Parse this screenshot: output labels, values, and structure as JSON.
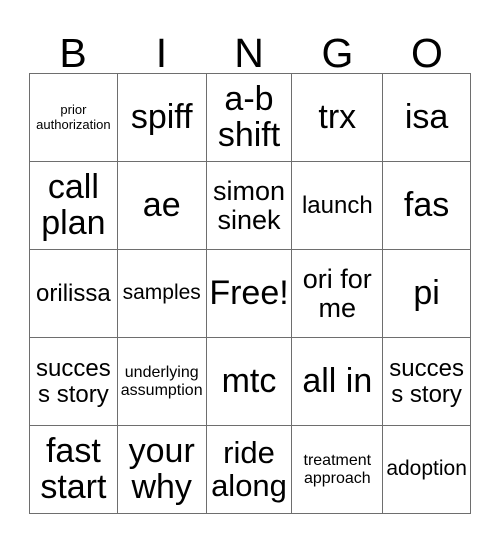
{
  "card": {
    "title_letters": [
      "B",
      "I",
      "N",
      "G",
      "O"
    ],
    "free_space_label": "Free!",
    "border_color": "#6e6e6e",
    "text_color": "#000000",
    "background_color": "#ffffff",
    "rows": [
      [
        {
          "text": "prior authorization",
          "size": "sz-xs"
        },
        {
          "text": "spiff",
          "size": "sz-xxl"
        },
        {
          "text": "a-b shift",
          "size": "sz-xxl"
        },
        {
          "text": "trx",
          "size": "sz-xxl"
        },
        {
          "text": "isa",
          "size": "sz-xxl"
        }
      ],
      [
        {
          "text": "call plan",
          "size": "sz-xxl"
        },
        {
          "text": "ae",
          "size": "sz-xxl"
        },
        {
          "text": "simon sinek",
          "size": "sz-l"
        },
        {
          "text": "launch",
          "size": "sz-ml"
        },
        {
          "text": "fas",
          "size": "sz-xxl"
        }
      ],
      [
        {
          "text": "orilissa",
          "size": "sz-ml"
        },
        {
          "text": "samples",
          "size": "sz-m"
        },
        {
          "text": "Free!",
          "size": "sz-xxl"
        },
        {
          "text": "ori for me",
          "size": "sz-l"
        },
        {
          "text": "pi",
          "size": "sz-xxl"
        }
      ],
      [
        {
          "text": "success story",
          "size": "sz-ml"
        },
        {
          "text": "underlying assumption",
          "size": "sz-s"
        },
        {
          "text": "mtc",
          "size": "sz-xxl"
        },
        {
          "text": "all in",
          "size": "sz-xxl"
        },
        {
          "text": "success story",
          "size": "sz-ml"
        }
      ],
      [
        {
          "text": "fast start",
          "size": "sz-xxl"
        },
        {
          "text": "your why",
          "size": "sz-xxl"
        },
        {
          "text": "ride along",
          "size": "sz-xl"
        },
        {
          "text": "treatment approach",
          "size": "sz-s"
        },
        {
          "text": "adoption",
          "size": "sz-m"
        }
      ]
    ]
  }
}
